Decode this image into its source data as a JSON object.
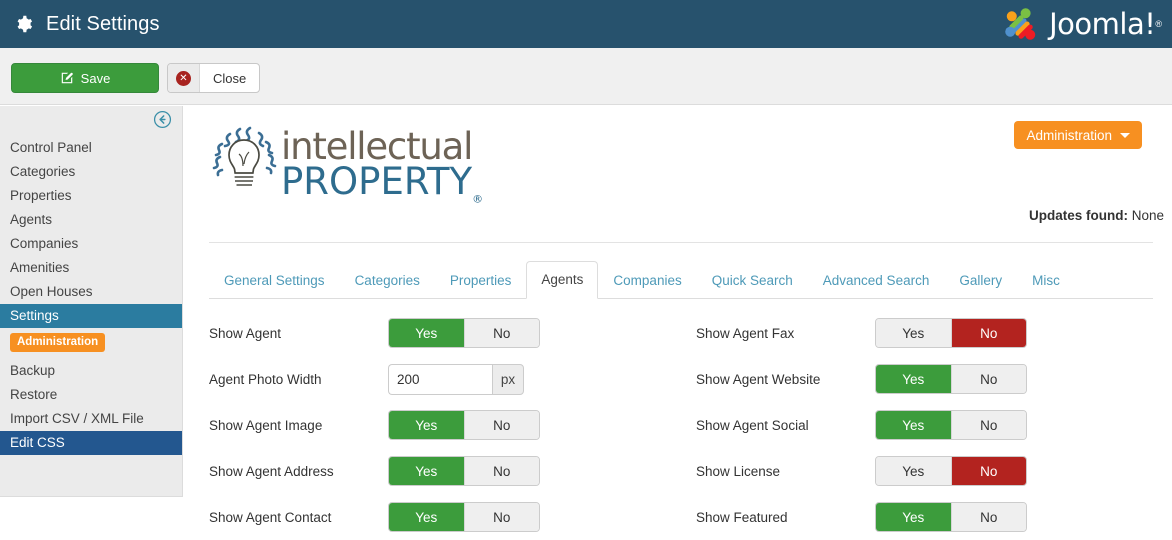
{
  "header": {
    "title": "Edit Settings",
    "gear_icon": "gear-icon",
    "brand": "Joomla!",
    "brand_reg": "®"
  },
  "toolbar": {
    "save_label": "Save",
    "close_label": "Close",
    "save_icon": "edit-square-icon",
    "close_icon": "x-circle-icon"
  },
  "sidebar": {
    "back_icon": "back-circle-arrow-icon",
    "items": [
      {
        "label": "Control Panel",
        "state": "normal"
      },
      {
        "label": "Categories",
        "state": "normal"
      },
      {
        "label": "Properties",
        "state": "normal"
      },
      {
        "label": "Agents",
        "state": "normal"
      },
      {
        "label": "Companies",
        "state": "normal"
      },
      {
        "label": "Amenities",
        "state": "normal"
      },
      {
        "label": "Open Houses",
        "state": "normal"
      },
      {
        "label": "Settings",
        "state": "active-teal"
      }
    ],
    "badge": "Administration",
    "items2": [
      {
        "label": "Backup",
        "state": "normal"
      },
      {
        "label": "Restore",
        "state": "normal"
      },
      {
        "label": "Import CSV / XML File",
        "state": "normal"
      },
      {
        "label": "Edit CSS",
        "state": "active-blue"
      }
    ]
  },
  "logo": {
    "line1": "intellectual",
    "line2": "PROPERTY",
    "registered": "®",
    "icon": "lightbulb-rays-icon"
  },
  "admin": {
    "label": "Administration",
    "caret_icon": "chevron-down-icon"
  },
  "updates": {
    "label": "Updates found:",
    "value": " None"
  },
  "tabs": [
    {
      "label": "General Settings",
      "active": false
    },
    {
      "label": "Categories",
      "active": false
    },
    {
      "label": "Properties",
      "active": false
    },
    {
      "label": "Agents",
      "active": true
    },
    {
      "label": "Companies",
      "active": false
    },
    {
      "label": "Quick Search",
      "active": false
    },
    {
      "label": "Advanced Search",
      "active": false
    },
    {
      "label": "Gallery",
      "active": false
    },
    {
      "label": "Misc",
      "active": false
    }
  ],
  "form": {
    "yes_label": "Yes",
    "no_label": "No",
    "left": [
      {
        "label": "Show Agent",
        "type": "toggle",
        "value": "Yes"
      },
      {
        "label": "Agent Photo Width",
        "type": "input",
        "value": "200",
        "unit": "px",
        "placeholder": ""
      },
      {
        "label": "Show Agent Image",
        "type": "toggle",
        "value": "Yes"
      },
      {
        "label": "Show Agent Address",
        "type": "toggle",
        "value": "Yes"
      },
      {
        "label": "Show Agent Contact",
        "type": "toggle",
        "value": "Yes"
      }
    ],
    "right": [
      {
        "label": "Show Agent Fax",
        "type": "toggle",
        "value": "No"
      },
      {
        "label": "Show Agent Website",
        "type": "toggle",
        "value": "Yes"
      },
      {
        "label": "Show Agent Social",
        "type": "toggle",
        "value": "Yes"
      },
      {
        "label": "Show License",
        "type": "toggle",
        "value": "No"
      },
      {
        "label": "Show Featured",
        "type": "toggle",
        "value": "Yes"
      }
    ]
  },
  "colors": {
    "header_bg": "#27526d",
    "green": "#3c9c3c",
    "red": "#b3231f",
    "orange": "#f79021",
    "teal": "#2b7ca0",
    "blue": "#23578f",
    "tab_link": "#4e9ab8"
  }
}
